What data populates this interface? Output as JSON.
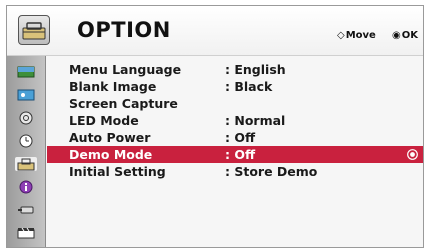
{
  "header": {
    "title": "OPTION",
    "move_hint": "Move",
    "ok_hint": "OK",
    "move_glyph": "◇",
    "ok_glyph": "◉"
  },
  "sidebar": {
    "icons": [
      "picture-icon",
      "screen-icon",
      "audio-icon",
      "time-icon",
      "option-icon",
      "info-icon",
      "input-icon",
      "media-icon"
    ],
    "active_index": 4
  },
  "menu": {
    "rows": [
      {
        "label": "Menu Language",
        "sep": ":",
        "value": "English"
      },
      {
        "label": "Blank Image",
        "sep": ":",
        "value": "Black"
      },
      {
        "label": "Screen Capture",
        "sep": "",
        "value": ""
      },
      {
        "label": "LED Mode",
        "sep": ":",
        "value": "Normal"
      },
      {
        "label": "Auto Power",
        "sep": ":",
        "value": "Off"
      },
      {
        "label": "Demo Mode",
        "sep": ":",
        "value": "Off"
      },
      {
        "label": "Initial Setting",
        "sep": ":",
        "value": "Store Demo"
      }
    ],
    "selected_index": 5
  },
  "colors": {
    "selection": "#c9213e",
    "text": "#1a1a1a",
    "sidebar": "#b0b0b0"
  }
}
